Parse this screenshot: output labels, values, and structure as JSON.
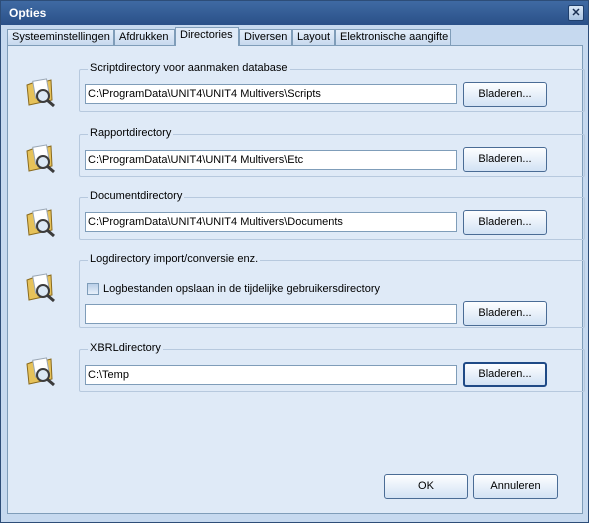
{
  "window": {
    "title": "Opties",
    "close_icon": "close-icon"
  },
  "tabs": [
    {
      "label": "Systeeminstellingen",
      "active": false
    },
    {
      "label": "Afdrukken",
      "active": false
    },
    {
      "label": "Directories",
      "active": true
    },
    {
      "label": "Diversen",
      "active": false
    },
    {
      "label": "Layout",
      "active": false
    },
    {
      "label": "Elektronische aangifte",
      "active": false
    }
  ],
  "groups": {
    "scripts": {
      "label": "Scriptdirectory voor aanmaken database",
      "value": "C:\\ProgramData\\UNIT4\\UNIT4 Multivers\\Scripts",
      "browse": "Bladeren..."
    },
    "reports": {
      "label": "Rapportdirectory",
      "value": "C:\\ProgramData\\UNIT4\\UNIT4 Multivers\\Etc",
      "browse": "Bladeren..."
    },
    "documents": {
      "label": "Documentdirectory",
      "value": "C:\\ProgramData\\UNIT4\\UNIT4 Multivers\\Documents",
      "browse": "Bladeren..."
    },
    "log": {
      "label": "Logdirectory import/conversie enz.",
      "checkbox_label": "Logbestanden opslaan in de tijdelijke gebruikersdirectory",
      "checkbox_checked": false,
      "value": "",
      "browse": "Bladeren..."
    },
    "xbrl": {
      "label": "XBRLdirectory",
      "value": "C:\\Temp",
      "browse": "Bladeren..."
    }
  },
  "footer": {
    "ok": "OK",
    "cancel": "Annuleren"
  }
}
